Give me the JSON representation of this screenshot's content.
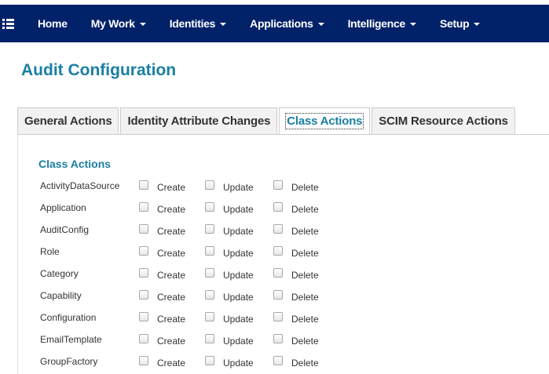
{
  "nav": {
    "menu_icon": "hamburger-list-icon",
    "items": [
      {
        "label": "Home",
        "dropdown": false
      },
      {
        "label": "My Work",
        "dropdown": true
      },
      {
        "label": "Identities",
        "dropdown": true
      },
      {
        "label": "Applications",
        "dropdown": true
      },
      {
        "label": "Intelligence",
        "dropdown": true
      },
      {
        "label": "Setup",
        "dropdown": true
      }
    ],
    "background_color": "#012169"
  },
  "page": {
    "title": "Audit Configuration",
    "accent_color": "#1a7fa3"
  },
  "tabs": [
    {
      "label": "General Actions",
      "active": false
    },
    {
      "label": "Identity Attribute Changes",
      "active": false
    },
    {
      "label": "Class Actions",
      "active": true
    },
    {
      "label": "SCIM Resource Actions",
      "active": false
    }
  ],
  "section": {
    "title": "Class Actions",
    "option_labels": {
      "create": "Create",
      "update": "Update",
      "delete": "Delete"
    },
    "rows": [
      {
        "label": "ActivityDataSource",
        "create": false,
        "update": false,
        "delete": false
      },
      {
        "label": "Application",
        "create": false,
        "update": false,
        "delete": false
      },
      {
        "label": "AuditConfig",
        "create": false,
        "update": false,
        "delete": false
      },
      {
        "label": "Role",
        "create": false,
        "update": false,
        "delete": false
      },
      {
        "label": "Category",
        "create": false,
        "update": false,
        "delete": false
      },
      {
        "label": "Capability",
        "create": false,
        "update": false,
        "delete": false
      },
      {
        "label": "Configuration",
        "create": false,
        "update": false,
        "delete": false
      },
      {
        "label": "EmailTemplate",
        "create": false,
        "update": false,
        "delete": false
      },
      {
        "label": "GroupFactory",
        "create": false,
        "update": false,
        "delete": false
      }
    ]
  }
}
